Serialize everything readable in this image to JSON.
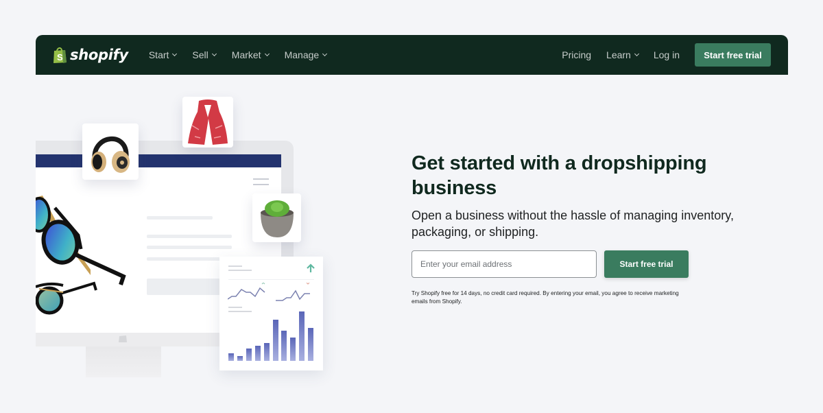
{
  "nav": {
    "logo_text": "shopify",
    "left_items": [
      {
        "label": "Start",
        "has_dropdown": true
      },
      {
        "label": "Sell",
        "has_dropdown": true
      },
      {
        "label": "Market",
        "has_dropdown": true
      },
      {
        "label": "Manage",
        "has_dropdown": true
      }
    ],
    "right_items": [
      {
        "label": "Pricing",
        "has_dropdown": false
      },
      {
        "label": "Learn",
        "has_dropdown": true
      },
      {
        "label": "Log in",
        "has_dropdown": false
      }
    ],
    "cta_label": "Start free trial"
  },
  "hero": {
    "title": "Get started with a dropshipping business",
    "subtitle": "Open a business without the hassle of managing inventory, packaging, or shipping.",
    "email_placeholder": "Enter your email address",
    "email_value": "",
    "cta_label": "Start free trial",
    "disclaimer": "Try Shopify free for 14 days, no credit card required. By entering your email, you agree to receive marketing emails from Shopify."
  },
  "illustration": {
    "products": [
      "headphones",
      "red scarf",
      "succulent plant",
      "sunglasses"
    ],
    "dashboard_bars": [
      0.18,
      0.12,
      0.3,
      0.36,
      0.43,
      1.0,
      0.73,
      0.56,
      1.2,
      0.8
    ],
    "trend": "up"
  },
  "colors": {
    "nav_bg": "#10291f",
    "accent": "#3a7c5f",
    "heading": "#10291f",
    "page_bg": "#f4f5f8",
    "screen_bar": "#23336e"
  }
}
